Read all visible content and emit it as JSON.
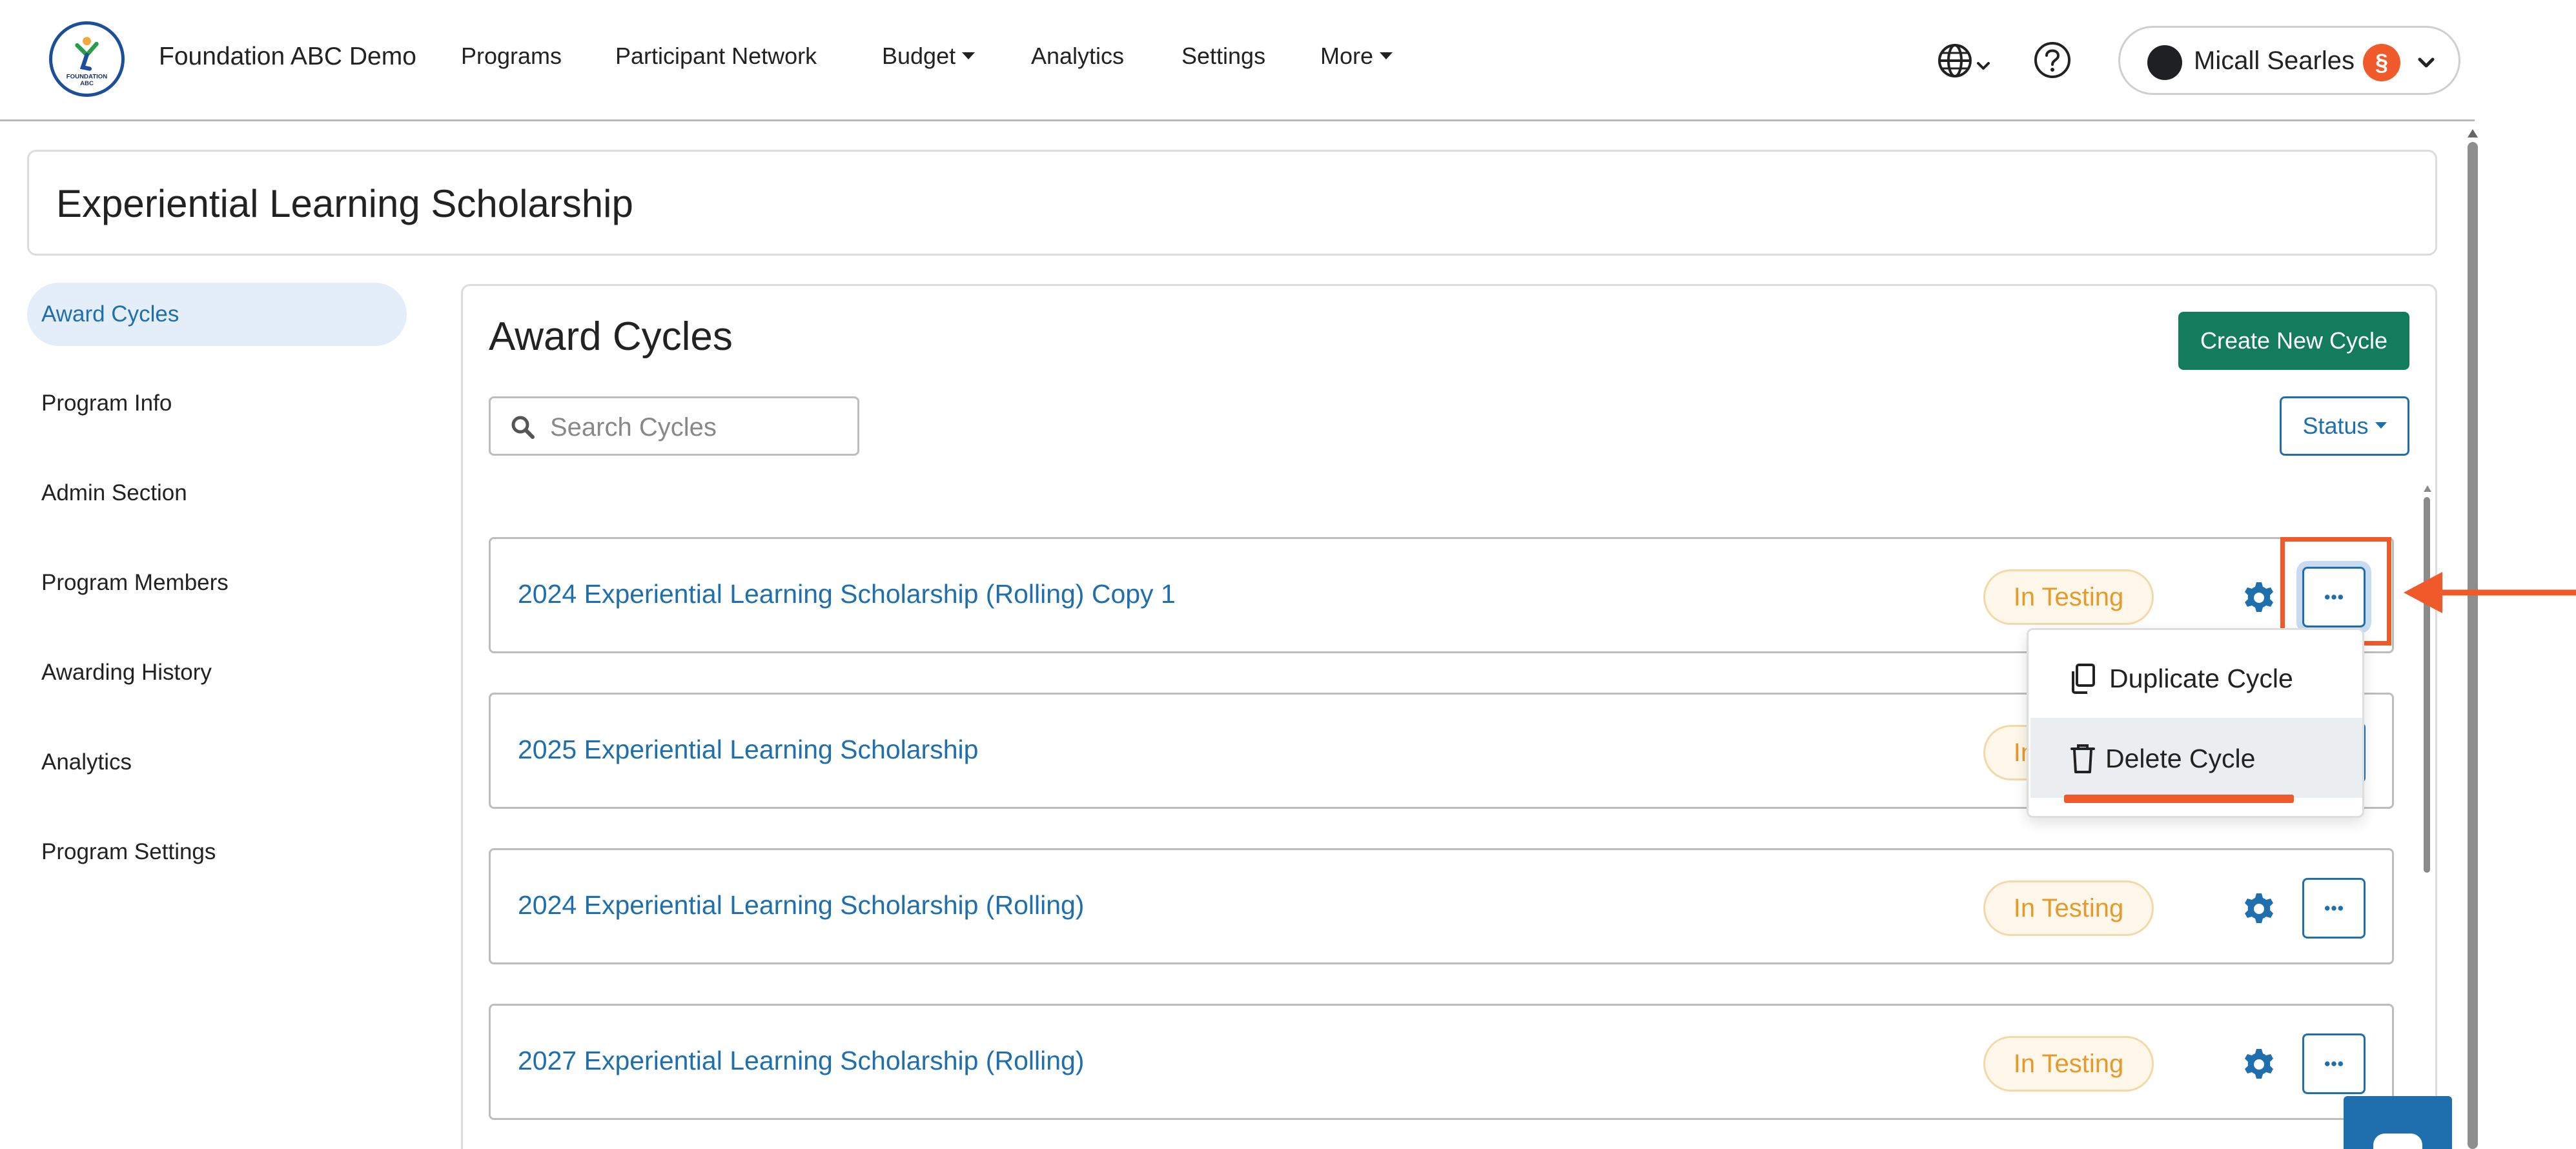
{
  "org": {
    "name": "Foundation ABC Demo",
    "logo_text": "FOUNDATION ABC"
  },
  "nav": {
    "items": [
      {
        "label": "Programs"
      },
      {
        "label": "Participant Network"
      },
      {
        "label": "Budget",
        "dropdown": true
      },
      {
        "label": "Analytics"
      },
      {
        "label": "Settings"
      },
      {
        "label": "More",
        "dropdown": true
      }
    ],
    "language_icon": "globe-icon",
    "help_icon": "question-circle-icon"
  },
  "user": {
    "name": "Micall Searles",
    "badge": "§"
  },
  "page": {
    "title": "Experiential Learning Scholarship"
  },
  "sidebar": {
    "items": [
      {
        "label": "Award Cycles",
        "active": true
      },
      {
        "label": "Program Info"
      },
      {
        "label": "Admin Section"
      },
      {
        "label": "Program Members"
      },
      {
        "label": "Awarding History"
      },
      {
        "label": "Analytics"
      },
      {
        "label": "Program Settings"
      }
    ]
  },
  "main": {
    "title": "Award Cycles",
    "create_button": "Create New Cycle",
    "search": {
      "placeholder": "Search Cycles",
      "value": ""
    },
    "status_filter": "Status",
    "cycles": [
      {
        "name": "2024 Experiential Learning Scholarship (Rolling) Copy 1",
        "status": "In Testing"
      },
      {
        "name": "2025 Experiential Learning Scholarship",
        "status": "In Testing"
      },
      {
        "name": "2024 Experiential Learning Scholarship (Rolling)",
        "status": "In Testing"
      },
      {
        "name": "2027 Experiential Learning Scholarship (Rolling)",
        "status": "In Testing"
      }
    ]
  },
  "dropdown": {
    "items": [
      {
        "label": "Duplicate Cycle",
        "icon": "copy-icon"
      },
      {
        "label": "Delete Cycle",
        "icon": "trash-icon"
      }
    ]
  },
  "colors": {
    "primary": "#1f6fae",
    "create_green": "#137c5b",
    "status_orange": "#e69a2c",
    "annotation": "#f05a2a"
  }
}
